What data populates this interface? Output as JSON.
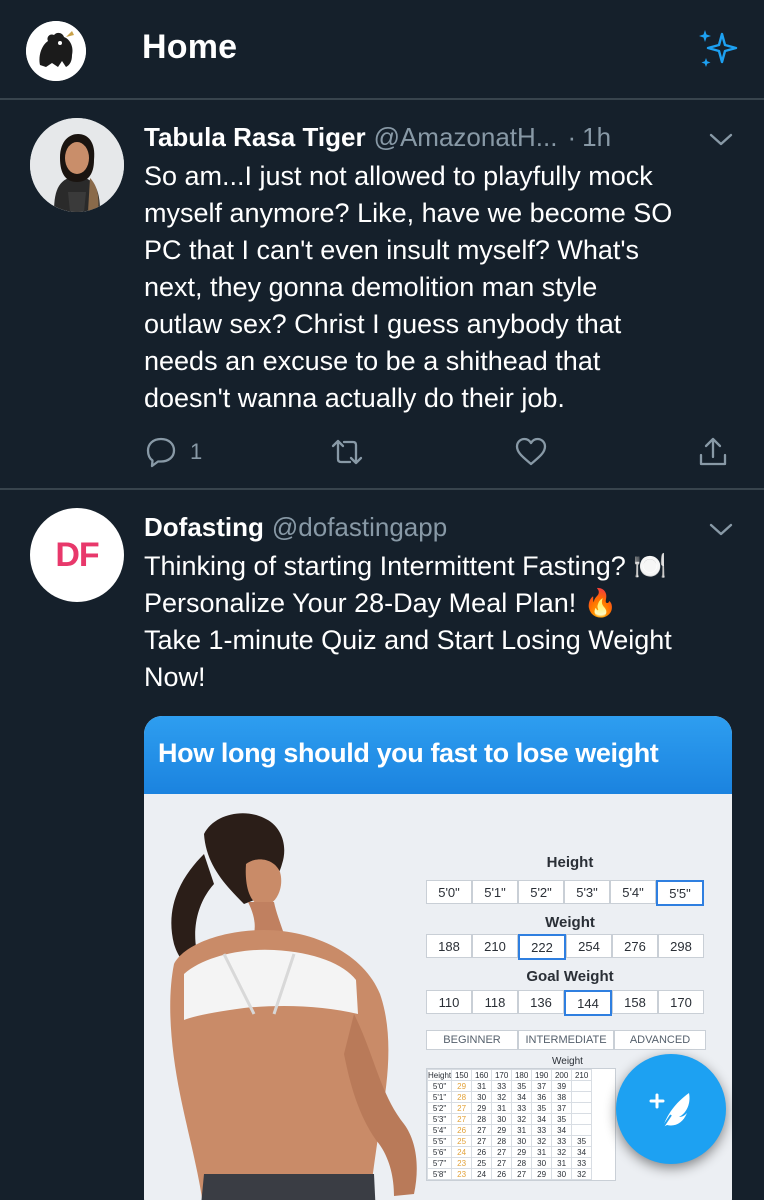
{
  "header": {
    "title": "Home"
  },
  "tweets": [
    {
      "name": "Tabula Rasa Tiger",
      "handle": "@AmazonatH...",
      "dot": "·",
      "time": "1h",
      "lines": [
        "So am...I just not allowed to playfully mock",
        "myself anymore? Like, have we become SO",
        "PC that I can't even insult myself? What's",
        "next, they gonna demolition man style",
        "outlaw sex? Christ I guess anybody that",
        "needs an excuse to be a shithead that",
        "doesn't wanna actually do their job."
      ],
      "reply_count": "1"
    },
    {
      "name": "Dofasting",
      "handle": "@dofastingapp",
      "avatar_text": "DF",
      "lines": [
        "Thinking of starting Intermittent Fasting? 🍽️",
        "Personalize Your 28-Day Meal Plan! 🔥",
        "Take 1-minute Quiz and Start Losing Weight",
        "Now!"
      ],
      "ad": {
        "banner": "How long should you fast to lose weight",
        "height_label": "Height",
        "heights": [
          "5'0\"",
          "5'1\"",
          "5'2\"",
          "5'3\"",
          "5'4\"",
          "5'5\""
        ],
        "weight_label": "Weight",
        "weights": [
          "188",
          "210",
          "222",
          "254",
          "276",
          "298"
        ],
        "goal_label": "Goal Weight",
        "goals": [
          "110",
          "118",
          "136",
          "144",
          "158",
          "170"
        ],
        "levels": [
          "BEGINNER",
          "INTERMEDIATE",
          "ADVANCED"
        ],
        "grid_title": "Weight",
        "grid_header": [
          "Height",
          "150",
          "160",
          "170",
          "180",
          "190",
          "200",
          "210"
        ],
        "grid_rows": [
          [
            "5'0\"",
            "29",
            "31",
            "33",
            "35",
            "37",
            "39",
            ""
          ],
          [
            "5'1\"",
            "28",
            "30",
            "32",
            "34",
            "36",
            "38",
            ""
          ],
          [
            "5'2\"",
            "27",
            "29",
            "31",
            "33",
            "35",
            "37",
            ""
          ],
          [
            "5'3\"",
            "27",
            "28",
            "30",
            "32",
            "34",
            "35",
            ""
          ],
          [
            "5'4\"",
            "26",
            "27",
            "29",
            "31",
            "33",
            "34",
            ""
          ],
          [
            "5'5\"",
            "25",
            "27",
            "28",
            "30",
            "32",
            "33",
            "35"
          ],
          [
            "5'6\"",
            "24",
            "26",
            "27",
            "29",
            "31",
            "32",
            "34"
          ],
          [
            "5'7\"",
            "23",
            "25",
            "27",
            "28",
            "30",
            "31",
            "33"
          ],
          [
            "5'8\"",
            "23",
            "24",
            "26",
            "27",
            "29",
            "30",
            "32"
          ]
        ]
      }
    }
  ],
  "colors": {
    "background": "#15202b",
    "accent": "#1da1f2",
    "secondary_text": "#8899a6",
    "divider": "#38444d"
  },
  "icons": [
    "bear-avatar-icon",
    "sparkle-icon",
    "chevron-down-icon",
    "reply-icon",
    "retweet-icon",
    "like-icon",
    "share-icon",
    "compose-tweet-icon"
  ]
}
